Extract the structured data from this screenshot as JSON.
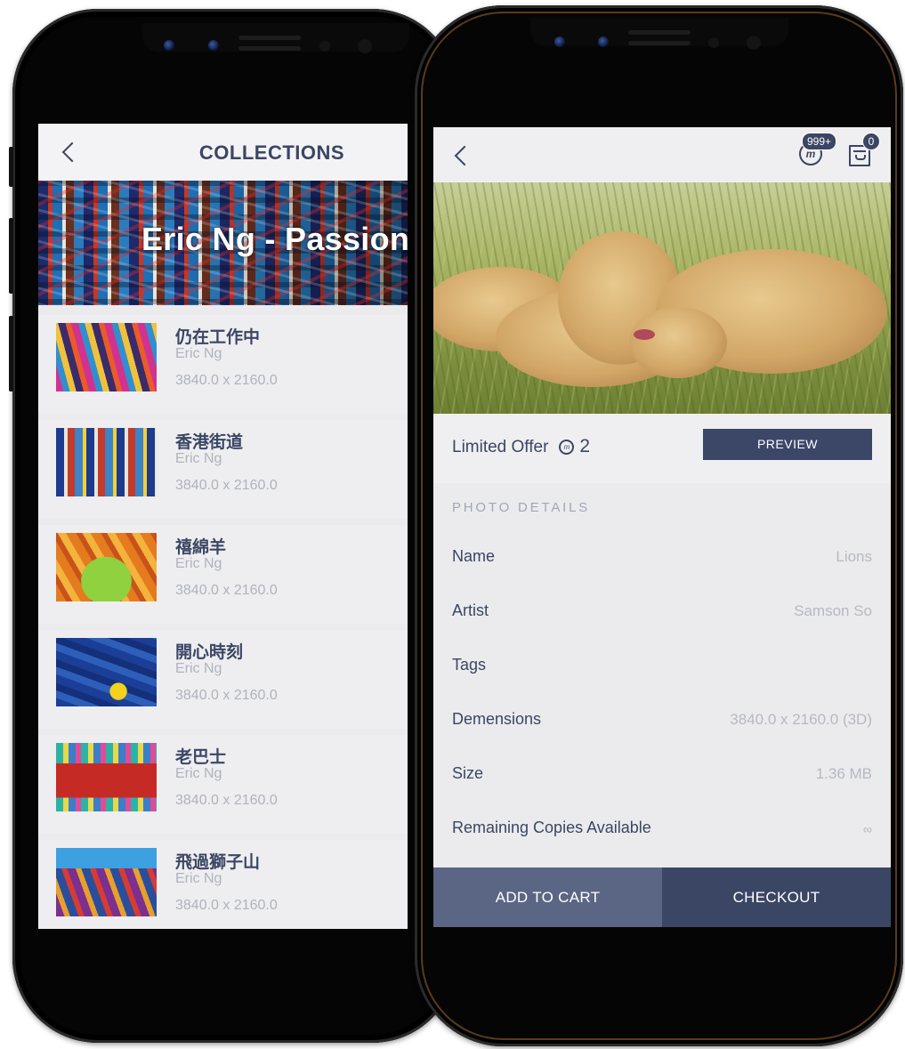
{
  "left_screen": {
    "title": "COLLECTIONS",
    "banner_title": "Eric Ng - Passion",
    "items": [
      {
        "title": "仍在工作中",
        "artist": "Eric Ng",
        "dimensions": "3840.0 x 2160.0"
      },
      {
        "title": "香港街道",
        "artist": "Eric Ng",
        "dimensions": "3840.0 x 2160.0"
      },
      {
        "title": "禧綿羊",
        "artist": "Eric Ng",
        "dimensions": "3840.0 x 2160.0"
      },
      {
        "title": "開心時刻",
        "artist": "Eric Ng",
        "dimensions": "3840.0 x 2160.0"
      },
      {
        "title": "老巴士",
        "artist": "Eric Ng",
        "dimensions": "3840.0 x 2160.0"
      },
      {
        "title": "飛過獅子山",
        "artist": "Eric Ng",
        "dimensions": "3840.0 x 2160.0"
      }
    ]
  },
  "right_screen": {
    "coin_badge": "999+",
    "cart_badge": "0",
    "offer_label": "Limited Offer",
    "offer_price": "2",
    "preview_label": "PREVIEW",
    "details_heading": "PHOTO DETAILS",
    "details": [
      {
        "label": "Name",
        "value": "Lions"
      },
      {
        "label": "Artist",
        "value": "Samson So"
      },
      {
        "label": "Tags",
        "value": ""
      },
      {
        "label": "Demensions",
        "value": "3840.0 x 2160.0 (3D)"
      },
      {
        "label": "Size",
        "value": "1.36 MB"
      },
      {
        "label": "Remaining Copies Available",
        "value": "∞"
      }
    ],
    "add_to_cart_label": "ADD TO CART",
    "checkout_label": "CHECKOUT"
  },
  "colors": {
    "accent": "#3b4664",
    "secondary_button": "#5b6684",
    "muted_text": "#b0b3bd",
    "screen_bg": "#ebebed"
  },
  "icons": [
    "back-chevron-icon",
    "coin-icon",
    "cart-icon",
    "offer-coin-icon"
  ]
}
